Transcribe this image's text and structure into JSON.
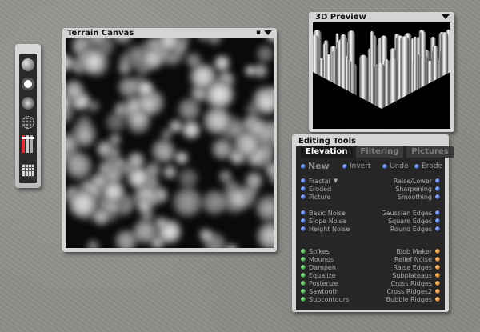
{
  "canvas": {
    "title": "Terrain Canvas"
  },
  "preview": {
    "title": "3D Preview"
  },
  "tools": {
    "title": "Editing Tools",
    "tabs": [
      "Elevation",
      "Filtering",
      "Pictures"
    ],
    "top_row": {
      "new": "New",
      "invert": "Invert",
      "undo": "Undo",
      "erode": "Erode"
    },
    "group1_left": [
      "Fractal",
      "Eroded",
      "Picture"
    ],
    "group1_right": [
      "Raise/Lower",
      "Sharpening",
      "Smoothing"
    ],
    "group2_left": [
      "Basic Noise",
      "Slope Noise",
      "Height Noise"
    ],
    "group2_right": [
      "Gaussian Edges",
      "Square Edges",
      "Round Edges"
    ],
    "group3_left": [
      "Spikes",
      "Mounds",
      "Dampen",
      "Equalize",
      "Posterize",
      "Sawtooth",
      "Subcontours"
    ],
    "group3_right": [
      "Blob Maker",
      "Relief Noise",
      "Raise Edges",
      "Subplateaus",
      "Cross Ridges",
      "Cross Ridges2",
      "Bubble Ridges"
    ]
  },
  "toolbar": {
    "icons": [
      "sphere-tool-icon",
      "circle-brush-icon",
      "soft-brush-icon",
      "dotted-brush-icon",
      "level-meter-icon",
      "grid-icon"
    ]
  },
  "colors": {
    "background": "#8e8e8a",
    "panel": "#d4d4d4",
    "dot_blue": "#2a4fb0",
    "dot_green": "#2a8a33",
    "dot_orange": "#c46a12"
  }
}
